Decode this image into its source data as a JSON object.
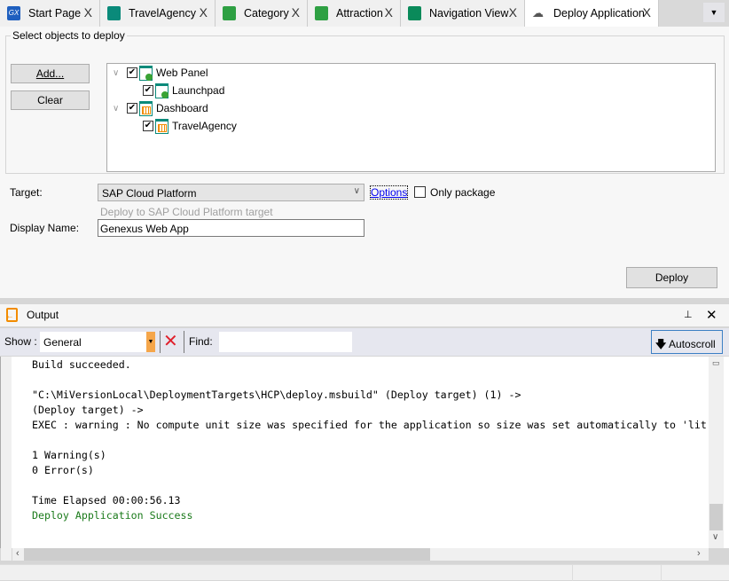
{
  "tabs": [
    {
      "label": "Start Page",
      "icon": "gx-logo-icon",
      "color": "#1f5fbf"
    },
    {
      "label": "TravelAgency",
      "icon": "dashboard-icon",
      "color": "#0a8a7a"
    },
    {
      "label": "Category",
      "icon": "transaction-icon",
      "color": "#2ea043"
    },
    {
      "label": "Attraction",
      "icon": "transaction-icon",
      "color": "#2ea043"
    },
    {
      "label": "Navigation View",
      "icon": "document-icon",
      "color": "#0a8a5a"
    },
    {
      "label": "Deploy Application",
      "icon": "cloud-upload-icon",
      "color": "#ffffff",
      "active": true
    }
  ],
  "close_glyph": "X",
  "deploy": {
    "group_label": "Select objects to deploy",
    "add_label": "Add...",
    "clear_label": "Clear",
    "tree": [
      {
        "label": "Web Panel",
        "checked": true,
        "level": 0,
        "icon": "web-panel-icon"
      },
      {
        "label": "Launchpad",
        "checked": true,
        "level": 1,
        "icon": "web-panel-icon"
      },
      {
        "label": "Dashboard",
        "checked": true,
        "level": 0,
        "icon": "dashboard-icon"
      },
      {
        "label": "TravelAgency",
        "checked": true,
        "level": 1,
        "icon": "dashboard-icon"
      }
    ],
    "target_label": "Target:",
    "target_value": "SAP Cloud Platform",
    "options_label": "Options",
    "only_package_label": "Only package",
    "only_package_checked": false,
    "target_hint": "Deploy to SAP Cloud Platform target",
    "display_name_label": "Display Name:",
    "display_name_value": "Genexus Web App",
    "deploy_label": "Deploy"
  },
  "output": {
    "title": "Output",
    "show_label": "Show :",
    "show_value": "General",
    "find_label": "Find:",
    "find_value": "",
    "autoscroll_label": "Autoscroll",
    "lines": [
      {
        "text": "Build succeeded.",
        "color": "#000000"
      },
      {
        "text": "",
        "color": "#000000"
      },
      {
        "text": "\"C:\\MiVersionLocal\\DeploymentTargets\\HCP\\deploy.msbuild\" (Deploy target) (1) ->",
        "color": "#000000"
      },
      {
        "text": "(Deploy target) ->",
        "color": "#000000"
      },
      {
        "text": "EXEC : warning : No compute unit size was specified for the application so size was set automatically to 'lit",
        "color": "#000000"
      },
      {
        "text": "",
        "color": "#000000"
      },
      {
        "text": "1 Warning(s)",
        "color": "#000000"
      },
      {
        "text": "0 Error(s)",
        "color": "#000000"
      },
      {
        "text": "",
        "color": "#000000"
      },
      {
        "text": "Time Elapsed 00:00:56.13",
        "color": "#000000"
      },
      {
        "text": "Deploy Application Success",
        "color": "#1a7a1a"
      }
    ]
  }
}
